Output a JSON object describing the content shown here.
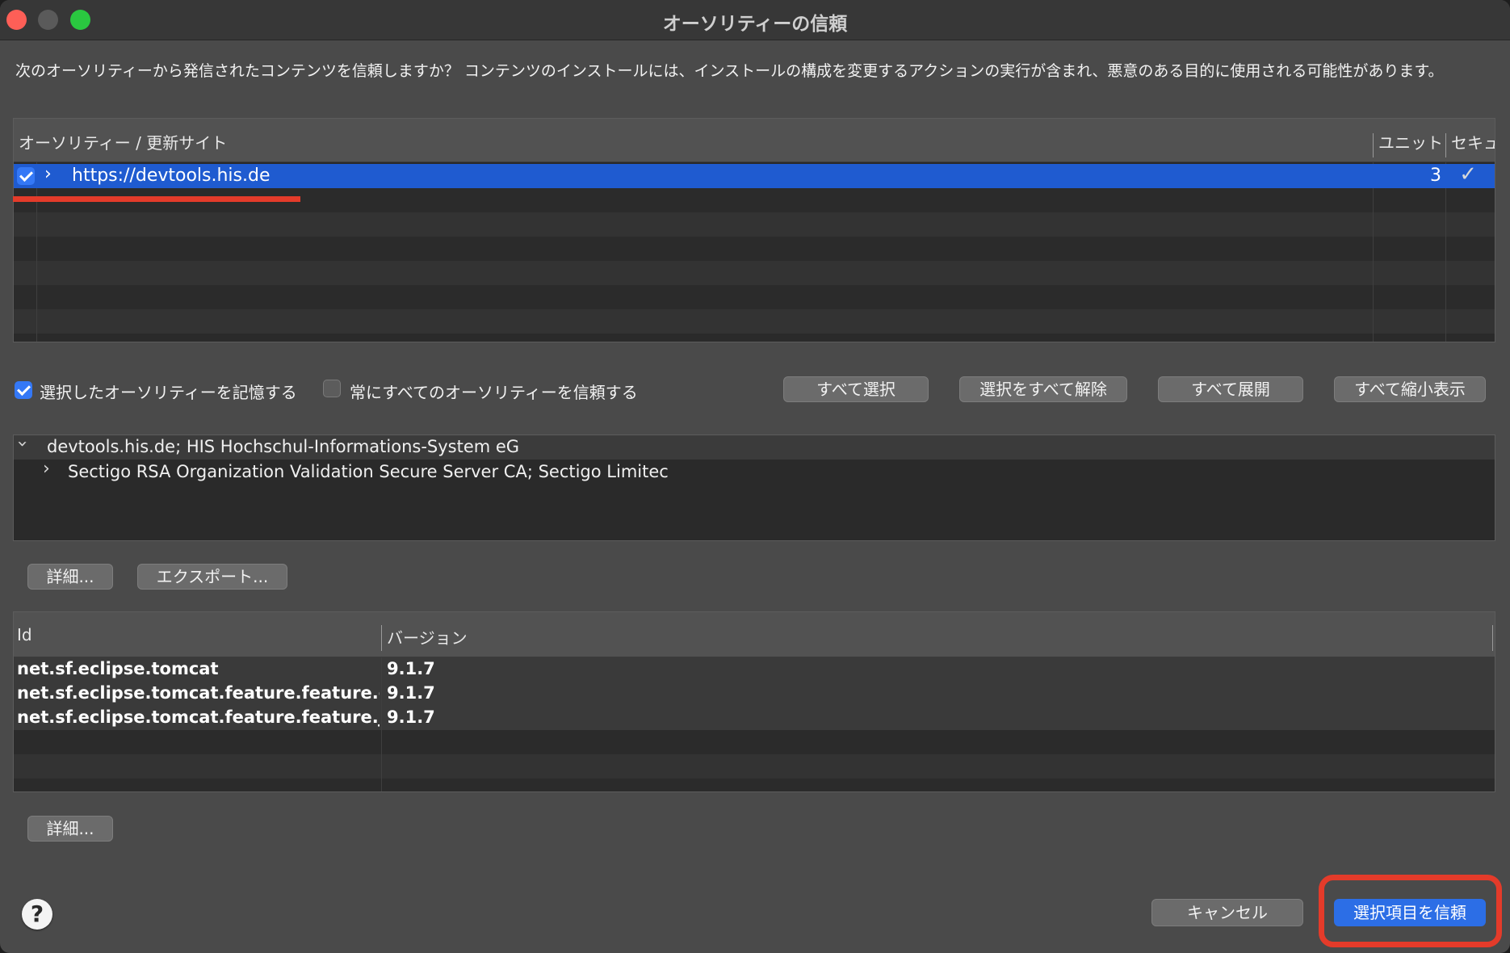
{
  "window": {
    "title": "オーソリティーの信頼"
  },
  "description": "次のオーソリティーから発信されたコンテンツを信頼しますか？ コンテンツのインストールには、インストールの構成を変更するアクションの実行が含まれ、悪意のある目的に使用される可能性があります。",
  "authority_table": {
    "columns": [
      "オーソリティー / 更新サイト",
      "ユニット",
      "セキュ"
    ],
    "rows": [
      {
        "checked": true,
        "url": "https://devtools.his.de",
        "units": "3",
        "secure": "✓"
      }
    ]
  },
  "options": {
    "remember_label": "選択したオーソリティーを記憶する",
    "remember_checked": true,
    "always_trust_label": "常にすべてのオーソリティーを信頼する",
    "always_trust_checked": false
  },
  "buttons": {
    "select_all": "すべて選択",
    "deselect_all": "選択をすべて解除",
    "expand_all": "すべて展開",
    "collapse_all": "すべて縮小表示",
    "details": "詳細...",
    "export": "エクスポート...",
    "details2": "詳細...",
    "cancel": "キャンセル",
    "trust_selected": "選択項目を信頼"
  },
  "certificate_tree": {
    "root": "devtools.his.de; HIS Hochschul-Informations-System eG",
    "child": "Sectigo RSA Organization Validation Secure Server CA; Sectigo Limitec"
  },
  "units_table": {
    "columns": [
      "Id",
      "バージョン"
    ],
    "rows": [
      {
        "id": "net.sf.eclipse.tomcat",
        "version": "9.1.7"
      },
      {
        "id": "net.sf.eclipse.tomcat.feature.feature.gro",
        "version": "9.1.7"
      },
      {
        "id": "net.sf.eclipse.tomcat.feature.feature.jar",
        "version": "9.1.7"
      }
    ]
  },
  "help": {
    "icon": "help-icon",
    "glyph": "?"
  },
  "colors": {
    "selection": "#1f5bd0",
    "accent_button": "#2c6ee6",
    "annotation_red": "#e43b2a",
    "checkbox_on": "#3478f6"
  }
}
